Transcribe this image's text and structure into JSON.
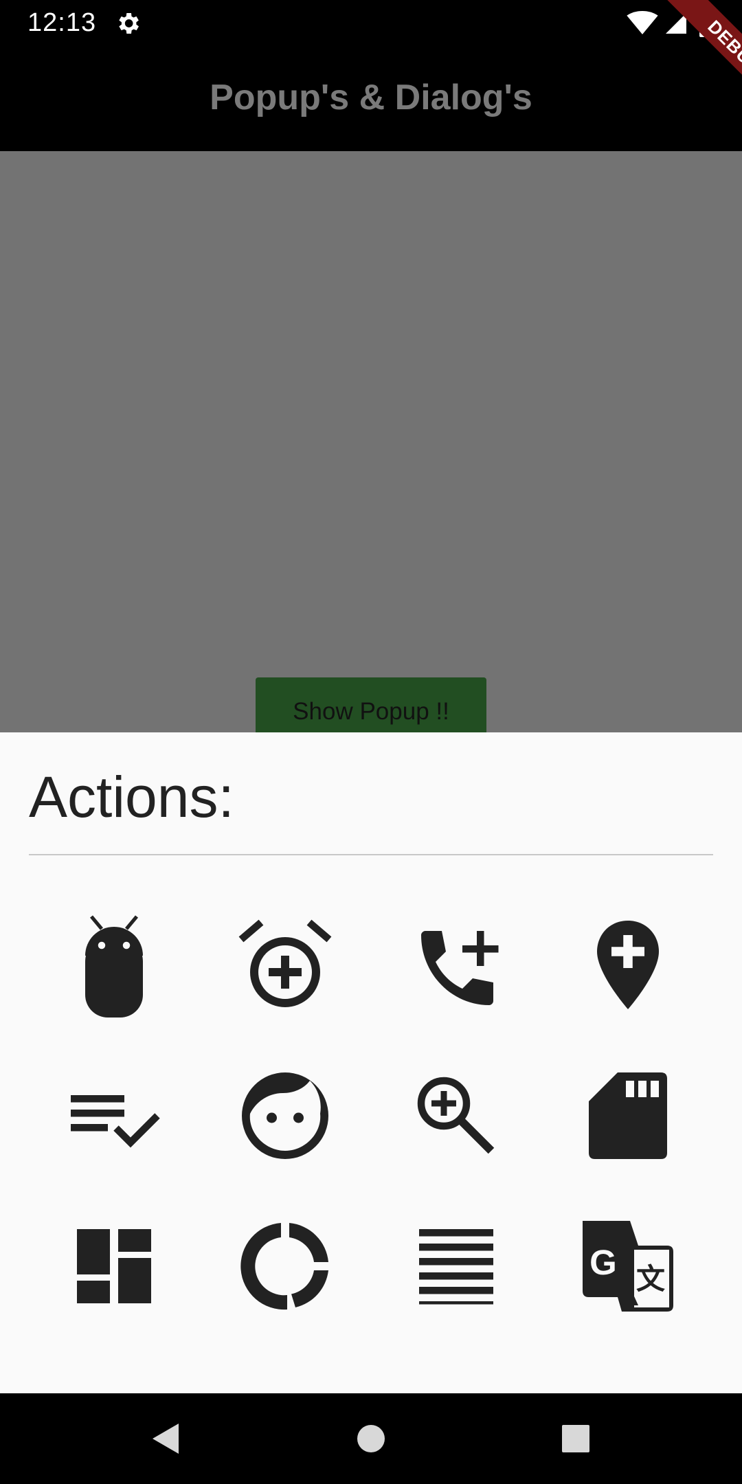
{
  "status_bar": {
    "time": "12:13",
    "icons": [
      "gear-icon",
      "wifi-icon",
      "signal-icon",
      "battery-icon"
    ]
  },
  "app_bar": {
    "title": "Popup's & Dialog's"
  },
  "debug_banner": {
    "label": "DEBUG"
  },
  "main": {
    "show_popup_label": "Show Popup !!"
  },
  "sheet": {
    "title": "Actions:",
    "icons": [
      "android-icon",
      "add-alarm-icon",
      "add-call-icon",
      "add-location-icon",
      "playlist-add-check-icon",
      "face-icon",
      "zoom-in-icon",
      "sd-card-icon",
      "dashboard-icon",
      "donut-large-icon",
      "format-align-justify-icon",
      "g-translate-icon"
    ]
  },
  "nav_bar": {
    "buttons": [
      "back-icon",
      "home-icon",
      "recents-icon"
    ]
  },
  "colors": {
    "icon": "#222222",
    "sheet_bg": "#fafafa",
    "scrim": "#737373",
    "button": "#224e22",
    "debug": "#7a1616"
  }
}
